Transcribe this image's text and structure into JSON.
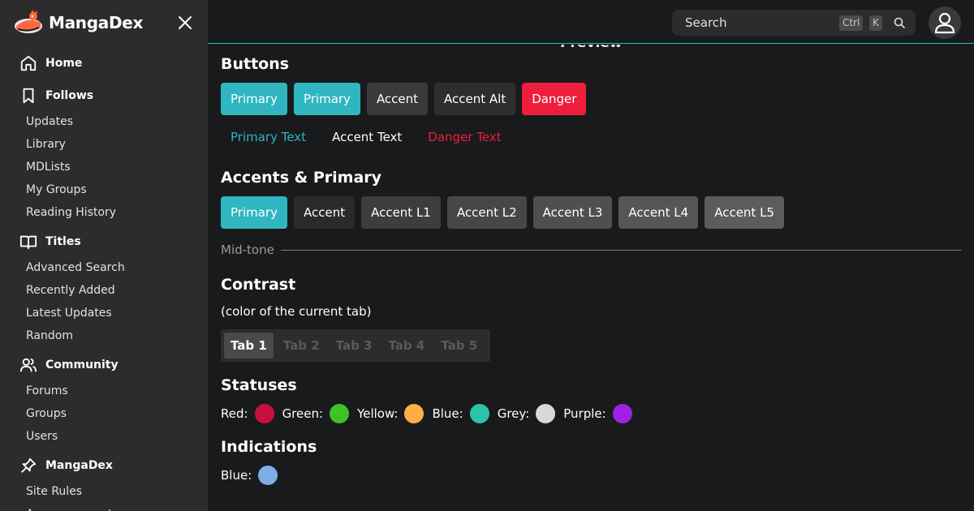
{
  "brand": {
    "name": "MangaDex",
    "logo_icon": "mangadex-cat-logo"
  },
  "sidebar": {
    "sections": [
      {
        "label": "Home",
        "icon": "home-icon",
        "items": []
      },
      {
        "label": "Follows",
        "icon": "bookmark-icon",
        "items": [
          "Updates",
          "Library",
          "MDLists",
          "My Groups",
          "Reading History"
        ]
      },
      {
        "label": "Titles",
        "icon": "book-icon",
        "items": [
          "Advanced Search",
          "Recently Added",
          "Latest Updates",
          "Random"
        ]
      },
      {
        "label": "Community",
        "icon": "users-icon",
        "items": [
          "Forums",
          "Groups",
          "Users"
        ]
      },
      {
        "label": "MangaDex",
        "icon": "pin-icon",
        "items": [
          "Site Rules",
          "Announcements"
        ]
      }
    ]
  },
  "header": {
    "search_placeholder": "Search",
    "shortcut_ctrl": "Ctrl",
    "shortcut_key": "K"
  },
  "main": {
    "preview_label": "Preview",
    "buttons": {
      "title": "Buttons",
      "filled": [
        "Primary",
        "Primary",
        "Accent",
        "Accent Alt",
        "Danger"
      ],
      "text": [
        "Primary Text",
        "Accent Text",
        "Danger Text"
      ]
    },
    "accents": {
      "title": "Accents & Primary",
      "items": [
        "Primary",
        "Accent",
        "Accent L1",
        "Accent L2",
        "Accent L3",
        "Accent L4",
        "Accent L5"
      ]
    },
    "midtone": "Mid-tone",
    "contrast": {
      "title": "Contrast",
      "subtitle": "(color of the current tab)",
      "tabs": [
        "Tab 1",
        "Tab 2",
        "Tab 3",
        "Tab 4",
        "Tab 5"
      ]
    },
    "statuses": {
      "title": "Statuses",
      "items": [
        {
          "label": "Red:",
          "color": "#c8103e"
        },
        {
          "label": "Green:",
          "color": "#3fc128"
        },
        {
          "label": "Yellow:",
          "color": "#ffaf45"
        },
        {
          "label": "Blue:",
          "color": "#2bc4a8"
        },
        {
          "label": "Grey:",
          "color": "#d8d8d8"
        },
        {
          "label": "Purple:",
          "color": "#a020e6"
        }
      ]
    },
    "indications": {
      "title": "Indications",
      "items": [
        {
          "label": "Blue:",
          "color": "#7eaee8"
        }
      ]
    }
  },
  "colors": {
    "primary": "#2fb6c0",
    "danger": "#ee1e3c",
    "accent": "#3a3a3a",
    "background": "#191a1c",
    "sidebar": "#2c2c2c"
  }
}
